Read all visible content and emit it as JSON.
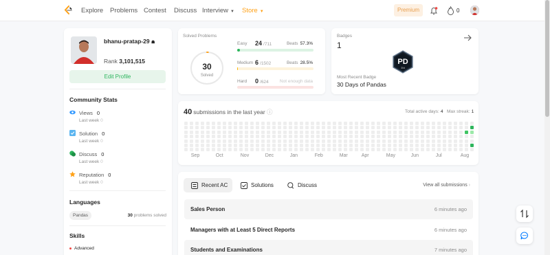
{
  "nav": {
    "items": [
      "Explore",
      "Problems",
      "Contest",
      "Discuss",
      "Interview",
      "Store"
    ],
    "premium": "Premium",
    "streak_count": "0"
  },
  "profile": {
    "username": "bhanu-pratap-29",
    "rank_label": "Rank",
    "rank_value": "3,101,515",
    "edit_label": "Edit Profile"
  },
  "community": {
    "title": "Community Stats",
    "stats": [
      {
        "label": "Views",
        "value": "0",
        "sub": "Last week",
        "sub_value": "0",
        "icon": "eye-icon",
        "color": "#3399ff"
      },
      {
        "label": "Solution",
        "value": "0",
        "sub": "Last week",
        "sub_value": "0",
        "icon": "solution-icon",
        "color": "#5bb5f0"
      },
      {
        "label": "Discuss",
        "value": "0",
        "sub": "Last week",
        "sub_value": "0",
        "icon": "discuss-icon",
        "color": "#2db55d"
      },
      {
        "label": "Reputation",
        "value": "0",
        "sub": "Last week",
        "sub_value": "0",
        "icon": "star-icon",
        "color": "#ffa116"
      }
    ]
  },
  "languages": {
    "title": "Languages",
    "items": [
      {
        "name": "Pandas",
        "count": "30",
        "suffix": "problems solved"
      }
    ]
  },
  "skills": {
    "title": "Skills",
    "items": [
      "Advanced"
    ]
  },
  "solved": {
    "title": "Solved Problems",
    "total": "30",
    "sub": "Solved",
    "progress": 0.0101,
    "difficulties": [
      {
        "name": "Easy",
        "count": "24",
        "total": "/711",
        "beats_label": "Beats",
        "beats": "57.3%",
        "fraction": 0.034,
        "fill": "#2db55d",
        "track": "#dcf3e3"
      },
      {
        "name": "Medium",
        "count": "6",
        "total": "/1502",
        "beats_label": "Beats",
        "beats": "28.5%",
        "fraction": 0.004,
        "fill": "#ffb800",
        "track": "#fdf3dc"
      },
      {
        "name": "Hard",
        "count": "0",
        "total": "/624",
        "beats_label": "Not enough data",
        "beats": "",
        "fraction": 0,
        "fill": "#ef4743",
        "track": "#fbe2e1"
      }
    ]
  },
  "badges": {
    "label": "Badges",
    "count": "1",
    "badge_text": "PD",
    "badge_sub": "30d",
    "recent_label": "Most Recent Badge",
    "recent_name": "30 Days of Pandas"
  },
  "submissions": {
    "count": "40",
    "text": "submissions in the last year",
    "active_label": "Total active days:",
    "active_value": "4",
    "streak_label": "Max streak:",
    "streak_value": "1",
    "months": [
      "Sep",
      "Oct",
      "Nov",
      "Dec",
      "Jan",
      "Feb",
      "Mar",
      "Apr",
      "May",
      "Jun",
      "Jul",
      "Aug"
    ],
    "active_days": [
      {
        "week": 0,
        "day": 1,
        "level": 3
      },
      {
        "week": 0,
        "day": 2,
        "level": 1
      },
      {
        "week": 1,
        "day": 2,
        "level": 2
      },
      {
        "week": 0,
        "day": 5,
        "level": 3
      }
    ]
  },
  "recent": {
    "tabs": [
      {
        "label": "Recent AC",
        "icon": "list-icon"
      },
      {
        "label": "Solutions",
        "icon": "solution-check-icon"
      },
      {
        "label": "Discuss",
        "icon": "discuss-bubble-icon"
      }
    ],
    "view_all": "View all submissions",
    "rows": [
      {
        "title": "Sales Person",
        "time": "6 minutes ago"
      },
      {
        "title": "Managers with at Least 5 Direct Reports",
        "time": "6 minutes ago"
      },
      {
        "title": "Students and Examinations",
        "time": "7 minutes ago"
      }
    ]
  }
}
